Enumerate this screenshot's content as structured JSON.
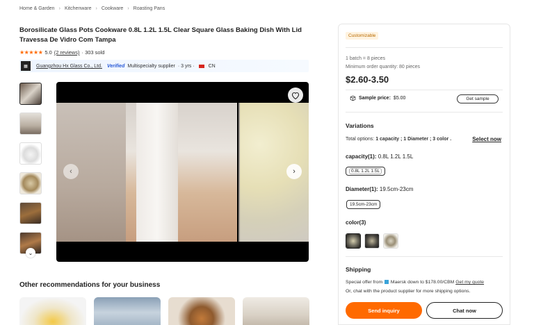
{
  "breadcrumb": [
    "Home & Garden",
    "Kitchenware",
    "Cookware",
    "Roasting Pans"
  ],
  "product": {
    "title": "Borosilicate Glass Pots Cookware 0.8L 1.2L 1.5L Clear Square Glass Baking Dish With Lid Travessa De Vidro Com Tampa",
    "rating": "5.0",
    "reviews": "(2 reviews)",
    "sold": "· 303 sold"
  },
  "supplier": {
    "name": "Guangzhou Hx Glass Co., Ltd.",
    "verified": "Verified",
    "type": "Multispecialty supplier",
    "years": "· 3 yrs ·",
    "country": "CN"
  },
  "recommendations": {
    "title": "Other recommendations for your business"
  },
  "panel": {
    "badge": "Customizable",
    "batch": "1 batch = 8 pieces",
    "min_order": "Minimum order quantity: 80 pieces",
    "price": "$2.60-3.50",
    "sample_label": "Sample price:",
    "sample_price": "$5.00",
    "get_sample": "Get sample",
    "variations_title": "Variations",
    "total_options_label": "Total options:",
    "total_options_value": "1 capacity ; 1 Diameter ; 3 color .",
    "select_now": "Select now",
    "capacity_label": "capacity(1):",
    "capacity_value": "0.8L 1.2L 1.5L",
    "capacity_chip": "0.8L 1.2L 1.5L",
    "diameter_label": "Diameter(1):",
    "diameter_value": "19.5cm-23cm",
    "diameter_chip": "19.5cm-23cm",
    "color_label": "color(3)",
    "shipping_title": "Shipping",
    "ship_line1_a": "Special offer from",
    "ship_line1_b": "Maersk down to $178.00/CBM",
    "ship_line1_link": "Get my quote",
    "ship_line2": "Or, chat with the product supplier for more shipping options.",
    "send_inquiry": "Send inquiry",
    "chat_now": "Chat now"
  },
  "colors": {
    "accent": "#ff6a00",
    "verified": "#2a5bd7"
  }
}
